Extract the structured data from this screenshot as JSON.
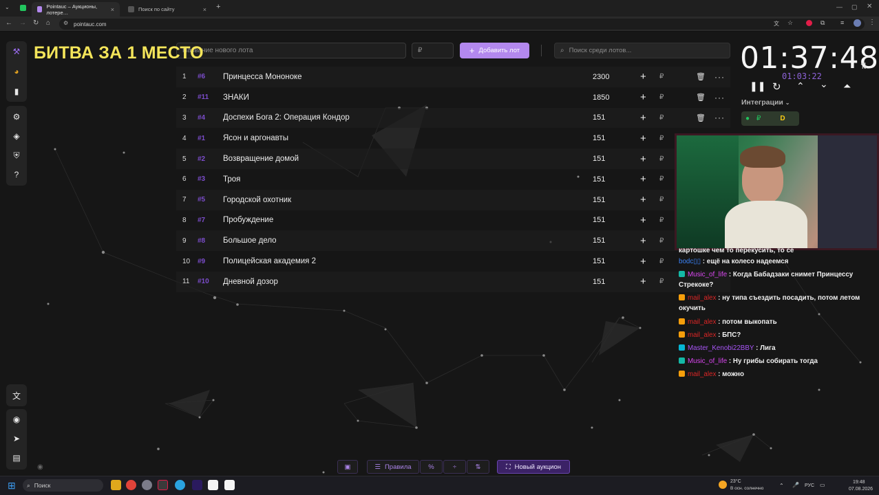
{
  "browser": {
    "tabs": [
      {
        "title": "Pointauc – Аукционы, лотере…",
        "active": true
      },
      {
        "title": "Поиск по сайту",
        "active": false
      }
    ],
    "url": "pointauc.com",
    "new_tab": "+"
  },
  "overlay_title": "БИТВА ЗА 1 МЕСТО",
  "toolbar": {
    "lot_name_placeholder": "Название нового лота",
    "price_placeholder": "₽",
    "add_lot_label": "Добавить лот",
    "search_placeholder": "Поиск среди лотов..."
  },
  "lots": [
    {
      "num": "1",
      "id": "#6",
      "name": "Принцесса Мононоке",
      "amount": "2300"
    },
    {
      "num": "2",
      "id": "#11",
      "name": "ЗНАКИ",
      "amount": "1850"
    },
    {
      "num": "3",
      "id": "#4",
      "name": "Доспехи Бога 2: Операция Кондор",
      "amount": "151"
    },
    {
      "num": "4",
      "id": "#1",
      "name": "Ясон и аргонавты",
      "amount": "151"
    },
    {
      "num": "5",
      "id": "#2",
      "name": "Возвращение домой",
      "amount": "151"
    },
    {
      "num": "6",
      "id": "#3",
      "name": "Троя",
      "amount": "151"
    },
    {
      "num": "7",
      "id": "#5",
      "name": "Городской охотник",
      "amount": "151"
    },
    {
      "num": "8",
      "id": "#7",
      "name": "Пробуждение",
      "amount": "151"
    },
    {
      "num": "9",
      "id": "#8",
      "name": "Большое дело",
      "amount": "151"
    },
    {
      "num": "10",
      "id": "#9",
      "name": "Полицейская академия 2",
      "amount": "151"
    },
    {
      "num": "11",
      "id": "#10",
      "name": "Дневной дозор",
      "amount": "151"
    }
  ],
  "lot_row": {
    "plus": "+",
    "currency": "₽",
    "delete_icon": "🗑",
    "more": "···"
  },
  "timer": {
    "main": "01:37:48",
    "sub": "01:03:22"
  },
  "integrations": {
    "label": "Интеграции",
    "dot": "●",
    "rub": "₽",
    "d": "D"
  },
  "chat": {
    "messages": [
      {
        "user": "",
        "text": "картошке чем то перекусить, то се",
        "color": "#f0f0f0"
      },
      {
        "user": "bodc▯▯",
        "text": ": ещё на колесо надеемся",
        "color": "#3b82f6"
      },
      {
        "user": "Music_of_life",
        "text": ": Когда Бабадзаки снимет Принцессу Стрекоке?",
        "color": "#d946ef"
      },
      {
        "user": "mail_alex",
        "text": ": ну типа съездить посадить, потом летом окучить",
        "color": "#dc2626"
      },
      {
        "user": "mail_alex",
        "text": ": потом выкопать",
        "color": "#dc2626"
      },
      {
        "user": "mail_alex",
        "text": ": БПС?",
        "color": "#dc2626"
      },
      {
        "user": "Master_Kenobi22BBY",
        "text": ": Лига",
        "color": "#a855f7"
      },
      {
        "user": "Music_of_life",
        "text": ": Ну грибы собирать тогда",
        "color": "#d946ef"
      },
      {
        "user": "mail_alex",
        "text": ": можно",
        "color": "#dc2626"
      }
    ]
  },
  "bottom_toolbar": {
    "rules_label": "Правила",
    "percent": "%",
    "new_auction_label": "Новый аукцион"
  },
  "taskbar": {
    "search_label": "Поиск",
    "weather_temp": "23°C",
    "weather_desc": "В осн. солнечно",
    "lang": "РУС",
    "time": "19:48",
    "date": "07.08.2026"
  },
  "colors": {
    "accent": "#b388ee",
    "lot_id": "#7c4dcc",
    "title": "#f4e55a"
  }
}
